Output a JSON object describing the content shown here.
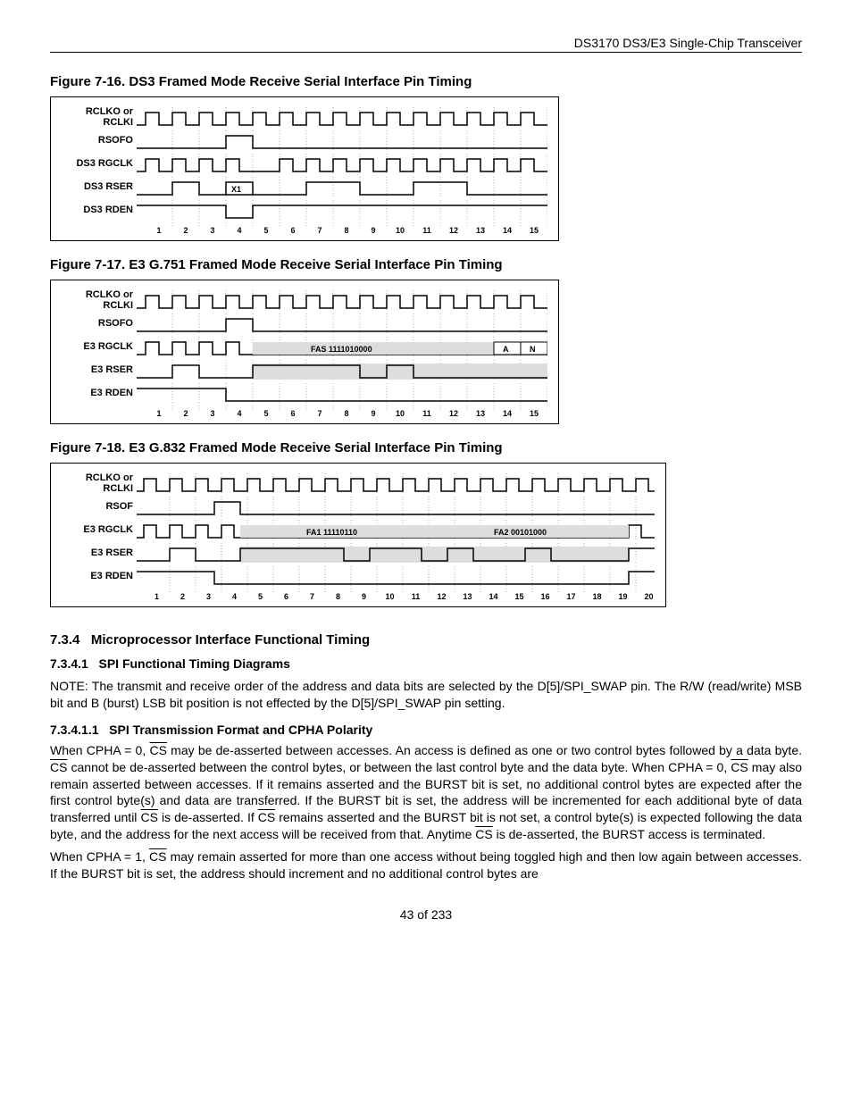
{
  "header": {
    "product": "DS3170 DS3/E3 Single-Chip Transceiver"
  },
  "figures": {
    "f16": {
      "title": "Figure 7-16. DS3 Framed Mode Receive Serial Interface Pin Timing",
      "signals": [
        "RCLKO or RCLKI",
        "RSOFO",
        "DS3 RGCLK",
        "DS3 RSER",
        "DS3 RDEN"
      ],
      "label_x1": "X1",
      "ticks": [
        "1",
        "2",
        "3",
        "4",
        "5",
        "6",
        "7",
        "8",
        "9",
        "10",
        "11",
        "12",
        "13",
        "14",
        "15"
      ]
    },
    "f17": {
      "title": "Figure 7-17. E3 G.751 Framed Mode Receive Serial Interface Pin Timing",
      "signals": [
        "RCLKO or RCLKI",
        "RSOFO",
        "E3 RGCLK",
        "E3 RSER",
        "E3 RDEN"
      ],
      "band1": "FAS 1111010000",
      "labelA": "A",
      "labelN": "N",
      "ticks": [
        "1",
        "2",
        "3",
        "4",
        "5",
        "6",
        "7",
        "8",
        "9",
        "10",
        "11",
        "12",
        "13",
        "14",
        "15"
      ]
    },
    "f18": {
      "title": "Figure 7-18. E3 G.832 Framed Mode Receive Serial Interface Pin Timing",
      "signals": [
        "RCLKO or RCLKI",
        "RSOF",
        "E3 RGCLK",
        "E3 RSER",
        "E3 RDEN"
      ],
      "band1": "FA1 11110110",
      "band2": "FA2 00101000",
      "ticks": [
        "1",
        "2",
        "3",
        "4",
        "5",
        "6",
        "7",
        "8",
        "9",
        "10",
        "11",
        "12",
        "13",
        "14",
        "15",
        "16",
        "17",
        "18",
        "19",
        "20"
      ]
    }
  },
  "sections": {
    "s734": {
      "num": "7.3.4",
      "title": "Microprocessor Interface Functional Timing"
    },
    "s7341": {
      "num": "7.3.4.1",
      "title": "SPI Functional Timing Diagrams"
    },
    "note": "NOTE: The transmit and receive order of the address and data bits are selected by the D[5]/SPI_SWAP pin. The R/W (read/write) MSB bit and B (burst) LSB bit position is not effected by the D[5]/SPI_SWAP pin setting.",
    "s73411": {
      "num": "7.3.4.1.1",
      "title": "SPI Transmission Format and CPHA Polarity"
    },
    "p1a": "When CPHA = 0, ",
    "p1b": " may be de-asserted between accesses. An access is defined as one or two control bytes followed by a data byte. ",
    "p1c": " cannot be de-asserted between the control bytes, or between the last control byte and the data byte. When CPHA = 0, ",
    "p1d": " may also remain asserted between accesses. If it remains asserted and the BURST bit is set, no additional control bytes are expected after the first control byte(s) and data are transferred. If the BURST bit is set, the address will be incremented for each additional byte of data transferred until ",
    "p1e": " is de-asserted. If ",
    "p1f": " remains asserted and the BURST bit is not set, a control byte(s) is expected following the data byte, and the address for the next access will be received from that.  Anytime ",
    "p1g": " is de-asserted, the BURST access is terminated.",
    "p2a": "When CPHA = 1, ",
    "p2b": " may remain asserted for more than one access without being toggled high and then low again between accesses. If the BURST bit is set, the address should increment and no additional control bytes are",
    "cs": "CS"
  },
  "footer": {
    "page": "43 of 233"
  }
}
